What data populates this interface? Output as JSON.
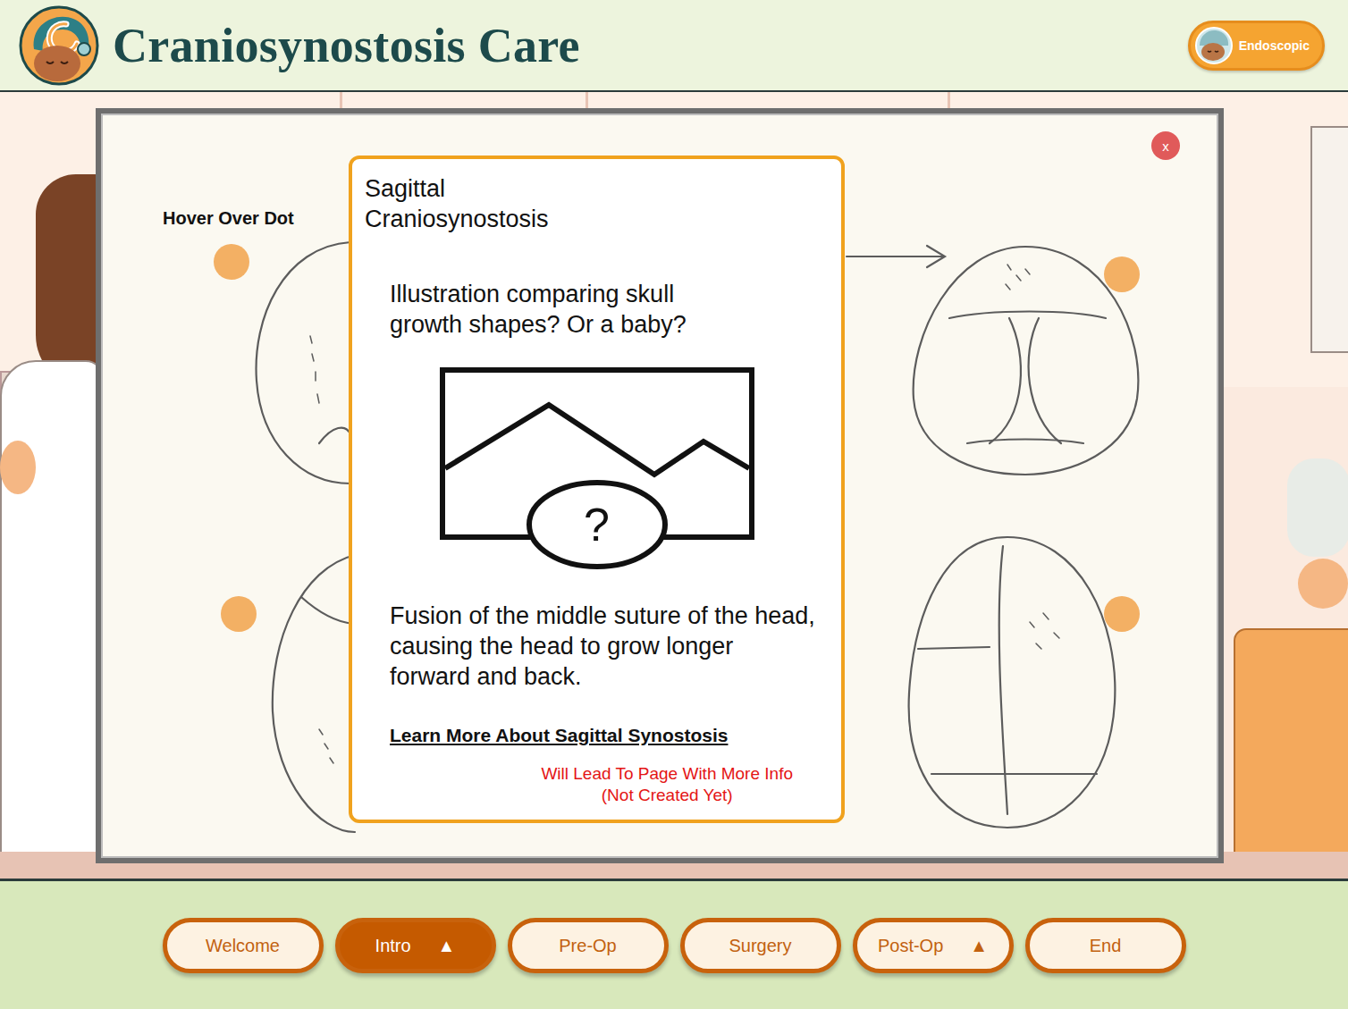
{
  "header": {
    "title": "Craniosynostosis Care",
    "mode": {
      "label": "Endoscopic"
    }
  },
  "board": {
    "hint": "Hover Over Dot",
    "close": "x"
  },
  "popup": {
    "title": "Sagittal Craniosynostosis",
    "caption": "Illustration comparing skull growth shapes? Or a baby?",
    "image_glyph": "?",
    "description": "Fusion of the middle suture of the head, causing the head to grow longer forward and back.",
    "link": "Learn More About Sagittal Synostosis",
    "note": [
      "Will Lead To Page With More Info",
      "(Not Created Yet)"
    ]
  },
  "nav": [
    {
      "label": "Welcome",
      "selected": false
    },
    {
      "label": "Intro",
      "selected": true,
      "icon": "▲"
    },
    {
      "label": "Pre-Op",
      "selected": false
    },
    {
      "label": "Surgery",
      "selected": false
    },
    {
      "label": "Post-Op",
      "selected": false,
      "icon": "▲"
    },
    {
      "label": "End",
      "selected": false
    }
  ]
}
